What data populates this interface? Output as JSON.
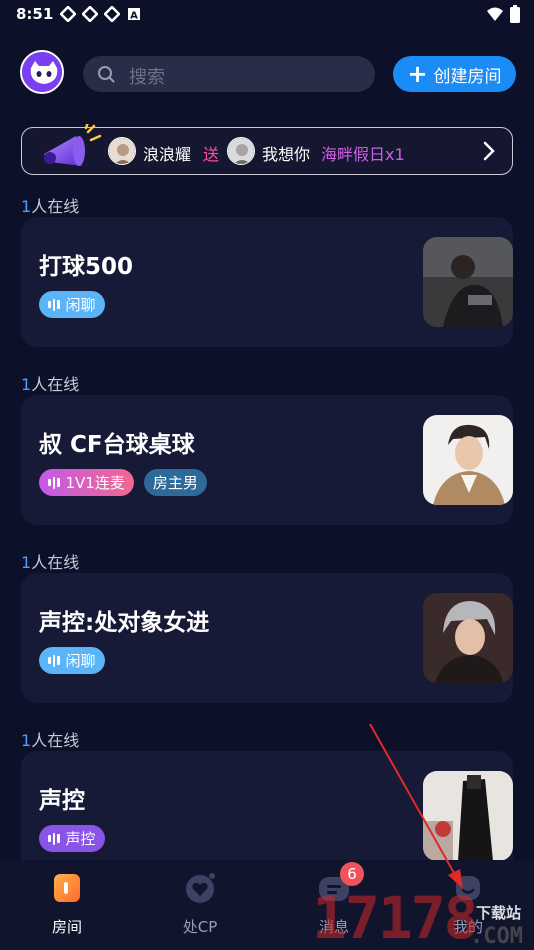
{
  "status_bar": {
    "time": "8:51"
  },
  "header": {
    "search_placeholder": "搜索",
    "create_button": "创建房间"
  },
  "banner": {
    "sender": "浪浪耀",
    "action": "送",
    "receiver": "我想你",
    "gift": "海畔假日x1"
  },
  "rooms": [
    {
      "online_count": "1",
      "online_label": "人在线",
      "title": "打球500",
      "tags": [
        {
          "label": "闲聊",
          "color": "#5ab4f7"
        }
      ]
    },
    {
      "online_count": "1",
      "online_label": "人在线",
      "title": "叔  CF台球桌球",
      "tags": [
        {
          "label": "1V1连麦",
          "color": "#c25ae8"
        },
        {
          "label": "房主男",
          "color": "#2d6a9a"
        }
      ]
    },
    {
      "online_count": "1",
      "online_label": "人在线",
      "title": "声控:处对象女进",
      "tags": [
        {
          "label": "闲聊",
          "color": "#5ab4f7"
        }
      ]
    },
    {
      "online_count": "1",
      "online_label": "人在线",
      "title": "声控",
      "tags": [
        {
          "label": "声控",
          "color": "#8a54e6"
        }
      ]
    }
  ],
  "bottom_nav": [
    {
      "label": "房间",
      "icon": "room-icon",
      "active": true
    },
    {
      "label": "处CP",
      "icon": "heart-icon",
      "active": false
    },
    {
      "label": "消息",
      "icon": "message-icon",
      "active": false
    },
    {
      "label": "我的",
      "icon": "profile-icon",
      "active": false
    }
  ],
  "message_badge": "6",
  "watermark": {
    "digits": "17178",
    "site": "下载站",
    "suffix": ".COM"
  },
  "colors": {
    "background": "#0d1029",
    "card": "#161a36",
    "accent_blue": "#1b8bf5",
    "gift_purple": "#d05ee6",
    "action_pink": "#ff4fa0"
  }
}
